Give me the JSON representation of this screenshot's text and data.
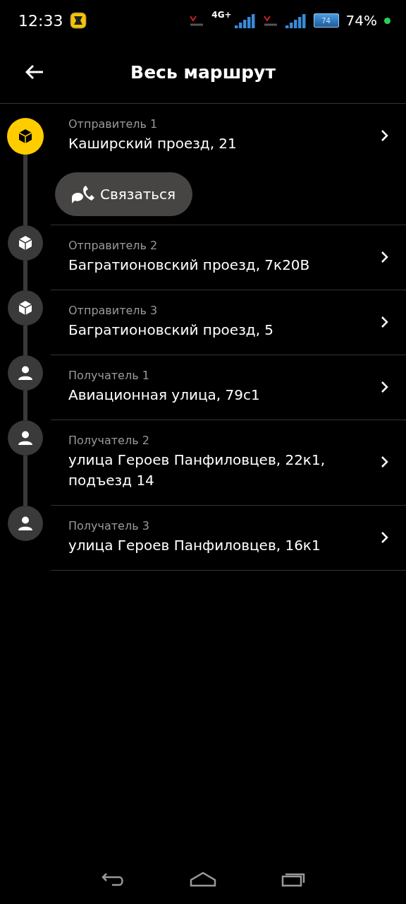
{
  "status_bar": {
    "time": "12:33",
    "network": "4G+",
    "battery_inside": "74",
    "battery": "74%"
  },
  "header": {
    "title": "Весь маршрут"
  },
  "stops": [
    {
      "kind": "sender",
      "active": true,
      "label": "Отправитель 1",
      "address": "Каширский проезд, 21",
      "contact_button": "Связаться"
    },
    {
      "kind": "sender",
      "active": false,
      "label": "Отправитель 2",
      "address": "Багратионовский проезд, 7к20В"
    },
    {
      "kind": "sender",
      "active": false,
      "label": "Отправитель 3",
      "address": "Багратионовский проезд, 5"
    },
    {
      "kind": "recipient",
      "active": false,
      "label": "Получатель 1",
      "address": "Авиационная улица, 79с1"
    },
    {
      "kind": "recipient",
      "active": false,
      "label": "Получатель 2",
      "address": "улица Героев Панфиловцев, 22к1, подъезд 14"
    },
    {
      "kind": "recipient",
      "active": false,
      "label": "Получатель 3",
      "address": "улица Героев Панфиловцев, 16к1"
    }
  ]
}
